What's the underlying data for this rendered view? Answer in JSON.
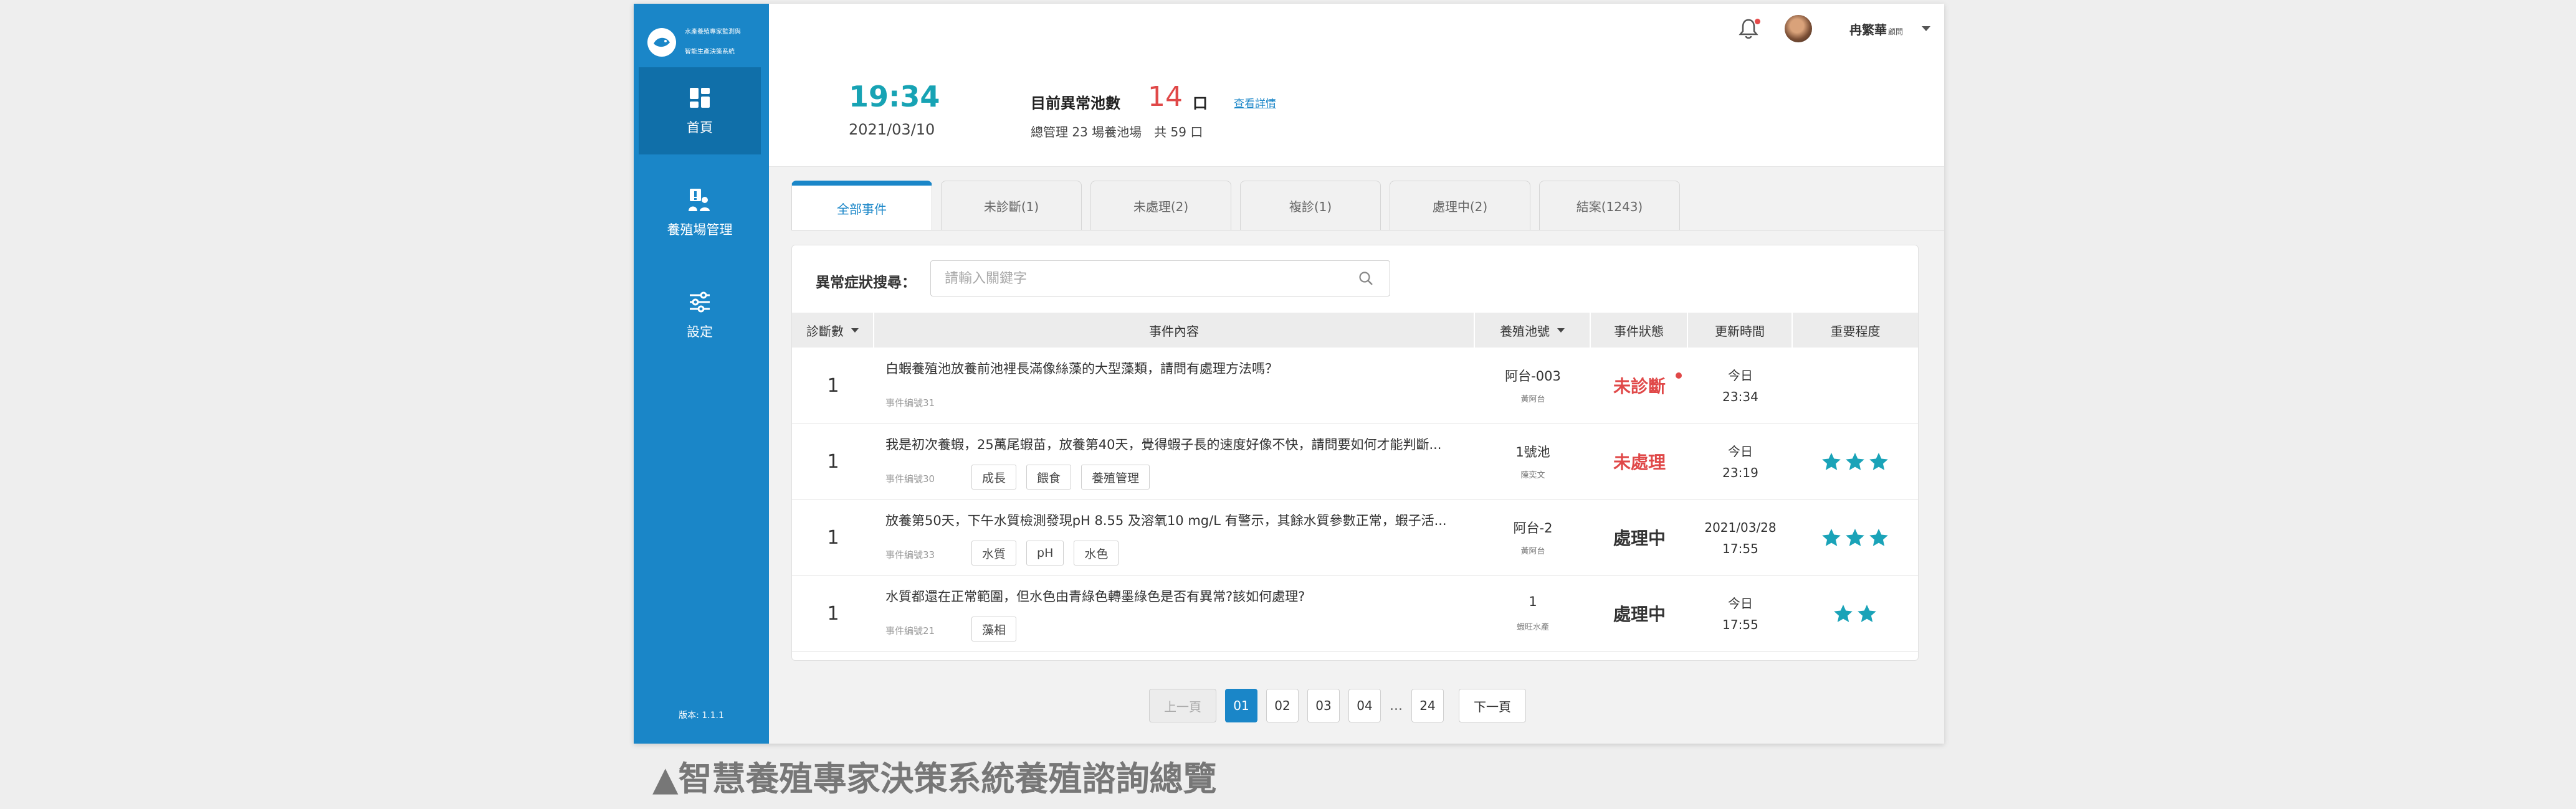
{
  "brand": {
    "line1": "水產養殖專家監測與",
    "line2": "智能生產決策系統"
  },
  "sidebar": {
    "items": [
      {
        "label": "首頁",
        "icon": "dashboard-icon",
        "active": true
      },
      {
        "label": "養殖場管理",
        "icon": "farm-management-icon",
        "active": false
      },
      {
        "label": "設定",
        "icon": "settings-sliders-icon",
        "active": false
      }
    ],
    "version": "版本: 1.1.1"
  },
  "topbar": {
    "user_name": "冉繁華",
    "user_role": "顧問"
  },
  "status": {
    "time": "19:34",
    "date": "2021/03/10",
    "abnormal_label": "目前異常池數",
    "abnormal_count": "14",
    "abnormal_unit": "口",
    "detail_link": "查看詳情",
    "summary": "總管理 23 場養池場　共 59 口"
  },
  "tabs": [
    "全部事件",
    "未診斷(1)",
    "未處理(2)",
    "複診(1)",
    "處理中(2)",
    "結案(1243)"
  ],
  "search": {
    "label": "異常症狀搜尋：",
    "placeholder": "請輸入關鍵字"
  },
  "table": {
    "headers": [
      "診斷數",
      "事件內容",
      "養殖池號",
      "事件狀態",
      "更新時間",
      "重要程度"
    ],
    "rows": [
      {
        "count": "1",
        "title": "白蝦養殖池放養前池裡長滿像絲藻的大型藻類，請問有處理方法嗎？",
        "id": "事件編號31",
        "tags": [],
        "pond": "阿台-003",
        "pond_sub": "黃阿台",
        "status": "未診斷",
        "status_color": "#e04848",
        "time1": "今日",
        "time2": "23:34",
        "stars": 0
      },
      {
        "count": "1",
        "title": "我是初次養蝦，25萬尾蝦苗，放養第40天，覺得蝦子長的速度好像不快，請問要如何才能判斷...",
        "id": "事件編號30",
        "tags": [
          "成長",
          "餵食",
          "養殖管理"
        ],
        "pond": "1號池",
        "pond_sub": "陳奕文",
        "status": "未處理",
        "status_color": "#e04848",
        "time1": "今日",
        "time2": "23:19",
        "stars": 3
      },
      {
        "count": "1",
        "title": "放養第50天，下午水質檢測發現pH 8.55 及溶氧10 mg/L 有警示，其餘水質參數正常，蝦子活...",
        "id": "事件編號33",
        "tags": [
          "水質",
          "pH",
          "水色"
        ],
        "pond": "阿台-2",
        "pond_sub": "黃阿台",
        "status": "處理中",
        "status_color": "#333333",
        "time1": "2021/03/28",
        "time2": "17:55",
        "stars": 3
      },
      {
        "count": "1",
        "title": "水質都還在正常範圍，但水色由青綠色轉墨綠色是否有異常?該如何處理?",
        "id": "事件編號21",
        "tags": [
          "藻相"
        ],
        "pond": "1",
        "pond_sub": "蝦旺水產",
        "status": "處理中",
        "status_color": "#333333",
        "time1": "今日",
        "time2": "17:55",
        "stars": 2
      }
    ]
  },
  "pagination": {
    "prev": "上一頁",
    "next": "下一頁",
    "pages": [
      "01",
      "02",
      "03",
      "04"
    ],
    "ellipsis": "...",
    "last": "24"
  },
  "colors": {
    "primary": "#1a86c8",
    "accent": "#17a3b4",
    "alert": "#e04848",
    "star": "#1aa3b8"
  },
  "caption": "▲智慧養殖專家決策系統養殖諮詢總覽"
}
